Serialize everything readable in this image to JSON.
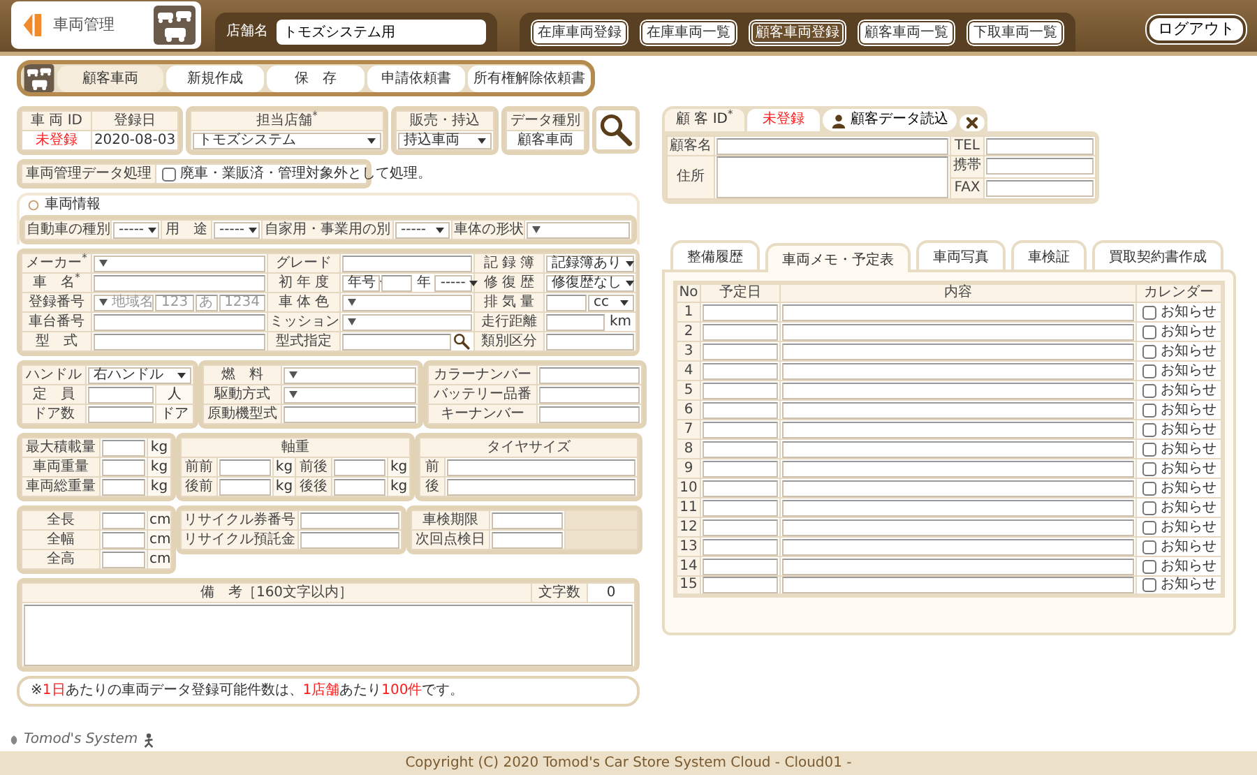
{
  "header": {
    "app_title": "車両管理",
    "store_label": "店舗名",
    "store_name": "トモズシステム用",
    "nav_buttons": [
      {
        "label": "在庫車両登録",
        "selected": false
      },
      {
        "label": "在庫車両一覧",
        "selected": false
      },
      {
        "label": "顧客車両登録",
        "selected": true
      },
      {
        "label": "顧客車両一覧",
        "selected": false
      },
      {
        "label": "下取車両一覧",
        "selected": false
      }
    ],
    "logout": "ログアウト"
  },
  "toolbar": [
    {
      "label": "顧客車両",
      "selected": true
    },
    {
      "label": "新規作成",
      "selected": false
    },
    {
      "label": "保　存",
      "selected": false
    },
    {
      "label": "申請依頼書",
      "selected": false
    },
    {
      "label": "所有権解除依頼書",
      "selected": false
    }
  ],
  "summary_boxes": [
    {
      "rows": [
        [
          {
            "kind": "label",
            "text": "車 両 ID"
          },
          {
            "kind": "label",
            "text": "登録日"
          }
        ],
        [
          {
            "kind": "text",
            "text": "未登録",
            "alert": true
          },
          {
            "kind": "text",
            "text": "2020-08-03",
            "alert": false
          }
        ]
      ]
    },
    {
      "rows": [
        [
          {
            "kind": "label",
            "text": "担当店舗$^{*}$"
          }
        ],
        [
          {
            "kind": "select",
            "value": "トモズシステム"
          }
        ]
      ]
    },
    {
      "rows": [
        [
          {
            "kind": "label",
            "text": "販売・持込"
          }
        ],
        [
          {
            "kind": "select",
            "value": "持込車両"
          }
        ]
      ]
    },
    {
      "rows": [
        [
          {
            "kind": "label",
            "text": "データ種別"
          }
        ],
        [
          {
            "kind": "text",
            "text": "顧客車両",
            "alert": false
          }
        ]
      ]
    }
  ],
  "disposal": {
    "label": "車両管理データ処理",
    "option": "廃車・業販済・管理対象外として処理。",
    "checked": false
  },
  "vehicle_info": {
    "title": "車両情報",
    "type_row": [
      {
        "kind": "label",
        "text": "自動車の種別"
      },
      {
        "kind": "select",
        "value": "-----"
      },
      {
        "kind": "label",
        "text": "用　途"
      },
      {
        "kind": "select",
        "value": "-----"
      },
      {
        "kind": "label",
        "text": "自家用・事業用の別"
      },
      {
        "kind": "select",
        "value": "-----"
      },
      {
        "kind": "label",
        "text": "車体の形状"
      },
      {
        "kind": "pick"
      }
    ],
    "main": [
      [
        {
          "kind": "label",
          "text": "メーカー$^{*}$"
        },
        {
          "kind": "pick"
        },
        {
          "kind": "label",
          "text": "グレード"
        },
        {
          "kind": "input"
        },
        {
          "kind": "label",
          "text": "記 録 簿"
        },
        {
          "kind": "select",
          "value": "記録簿あり"
        }
      ],
      [
        {
          "kind": "label",
          "text": "車　名$^{*}$"
        },
        {
          "kind": "input"
        },
        {
          "kind": "label",
          "text": "初 年 度"
        },
        {
          "kind": "group",
          "parts": [
            {
              "kind": "select",
              "value": "年号"
            },
            {
              "kind": "input"
            },
            {
              "kind": "unit",
              "text": "年"
            },
            {
              "kind": "select",
              "value": "-----"
            }
          ]
        },
        {
          "kind": "label",
          "text": "修 復 歴"
        },
        {
          "kind": "select",
          "value": "修復歴なし"
        }
      ],
      [
        {
          "kind": "label",
          "text": "登録番号"
        },
        {
          "kind": "group",
          "parts": [
            {
              "kind": "pick",
              "value": "地域名"
            },
            {
              "kind": "input",
              "placeholder": "123"
            },
            {
              "kind": "input",
              "placeholder": "あ"
            },
            {
              "kind": "input",
              "placeholder": "1234"
            }
          ]
        },
        {
          "kind": "label",
          "text": "車 体 色"
        },
        {
          "kind": "pick"
        },
        {
          "kind": "label",
          "text": "排 気 量"
        },
        {
          "kind": "group",
          "parts": [
            {
              "kind": "input"
            },
            {
              "kind": "select",
              "value": "cc"
            }
          ]
        }
      ],
      [
        {
          "kind": "label",
          "text": "車台番号"
        },
        {
          "kind": "input"
        },
        {
          "kind": "label",
          "text": "ミッション"
        },
        {
          "kind": "pick"
        },
        {
          "kind": "label",
          "text": "走行距離"
        },
        {
          "kind": "group",
          "parts": [
            {
              "kind": "input"
            },
            {
              "kind": "unit",
              "text": "km"
            }
          ]
        }
      ],
      [
        {
          "kind": "label",
          "text": "型　式"
        },
        {
          "kind": "input"
        },
        {
          "kind": "label",
          "text": "型式指定"
        },
        {
          "kind": "search"
        },
        {
          "kind": "label",
          "text": "類別区分"
        },
        {
          "kind": "input"
        }
      ]
    ],
    "panel_rows": [
      [
        {
          "rows": [
            [
              {
                "kind": "label",
                "text": "ハンドル"
              },
              {
                "kind": "select",
                "value": "右ハンドル",
                "colspan": 2
              }
            ],
            [
              {
                "kind": "label",
                "text": "定　員"
              },
              {
                "kind": "input"
              },
              {
                "kind": "unit",
                "text": "人"
              }
            ],
            [
              {
                "kind": "label",
                "text": "ドア数"
              },
              {
                "kind": "input"
              },
              {
                "kind": "unit",
                "text": "ドア"
              }
            ]
          ]
        },
        {
          "rows": [
            [
              {
                "kind": "label",
                "text": "燃　料"
              },
              {
                "kind": "pick"
              }
            ],
            [
              {
                "kind": "label",
                "text": "駆動方式"
              },
              {
                "kind": "pick"
              }
            ],
            [
              {
                "kind": "label",
                "text": "原動機型式"
              },
              {
                "kind": "input"
              }
            ]
          ]
        },
        {
          "rows": [
            [
              {
                "kind": "label",
                "text": "カラーナンバー"
              },
              {
                "kind": "input"
              }
            ],
            [
              {
                "kind": "label",
                "text": "バッテリー品番"
              },
              {
                "kind": "input"
              }
            ],
            [
              {
                "kind": "label",
                "text": "キーナンバー"
              },
              {
                "kind": "input"
              }
            ]
          ]
        }
      ],
      [
        {
          "rows": [
            [
              {
                "kind": "label",
                "text": "最大積載量"
              },
              {
                "kind": "input"
              },
              {
                "kind": "unit",
                "text": "kg"
              }
            ],
            [
              {
                "kind": "label",
                "text": "車両重量"
              },
              {
                "kind": "input"
              },
              {
                "kind": "unit",
                "text": "kg"
              }
            ],
            [
              {
                "kind": "label",
                "text": "車両総重量"
              },
              {
                "kind": "input"
              },
              {
                "kind": "unit",
                "text": "kg"
              }
            ]
          ]
        },
        {
          "rows": [
            [
              {
                "kind": "heading",
                "text": "軸重",
                "colspan": 6
              }
            ],
            [
              {
                "kind": "label",
                "text": "前前"
              },
              {
                "kind": "input"
              },
              {
                "kind": "unit",
                "text": "kg"
              },
              {
                "kind": "label",
                "text": "前後"
              },
              {
                "kind": "input"
              },
              {
                "kind": "unit",
                "text": "kg"
              }
            ],
            [
              {
                "kind": "label",
                "text": "後前"
              },
              {
                "kind": "input"
              },
              {
                "kind": "unit",
                "text": "kg"
              },
              {
                "kind": "label",
                "text": "後後"
              },
              {
                "kind": "input"
              },
              {
                "kind": "unit",
                "text": "kg"
              }
            ]
          ]
        },
        {
          "rows": [
            [
              {
                "kind": "heading",
                "text": "タイヤサイズ",
                "colspan": 2
              }
            ],
            [
              {
                "kind": "label",
                "text": "前"
              },
              {
                "kind": "input"
              }
            ],
            [
              {
                "kind": "label",
                "text": "後"
              },
              {
                "kind": "input"
              }
            ]
          ]
        }
      ],
      [
        {
          "rows": [
            [
              {
                "kind": "label",
                "text": "全長"
              },
              {
                "kind": "input"
              },
              {
                "kind": "unit",
                "text": "cm"
              }
            ],
            [
              {
                "kind": "label",
                "text": "全幅"
              },
              {
                "kind": "input"
              },
              {
                "kind": "unit",
                "text": "cm"
              }
            ],
            [
              {
                "kind": "label",
                "text": "全高"
              },
              {
                "kind": "input"
              },
              {
                "kind": "unit",
                "text": "cm"
              }
            ]
          ]
        },
        {
          "rows": [
            [
              {
                "kind": "label",
                "text": "リサイクル券番号"
              },
              {
                "kind": "input"
              }
            ],
            [
              {
                "kind": "label",
                "text": "リサイクル預託金"
              },
              {
                "kind": "input"
              }
            ]
          ]
        },
        {
          "rows": [
            [
              {
                "kind": "label",
                "text": "車検期限"
              },
              {
                "kind": "input"
              },
              {
                "kind": "blank"
              }
            ],
            [
              {
                "kind": "label",
                "text": "次回点検日"
              },
              {
                "kind": "input"
              },
              {
                "kind": "blank"
              }
            ]
          ]
        }
      ]
    ]
  },
  "remarks": {
    "label": "備　考［160文字以内］",
    "count_label": "文字数",
    "count": "0"
  },
  "note": [
    {
      "text": "※",
      "highlight": false
    },
    {
      "text": "1日",
      "highlight": true
    },
    {
      "text": "あたりの車両データ登録可能件数は、",
      "highlight": false
    },
    {
      "text": "1店舗",
      "highlight": true
    },
    {
      "text": "あたり",
      "highlight": false
    },
    {
      "text": "100件",
      "highlight": true
    },
    {
      "text": "です。",
      "highlight": false
    }
  ],
  "customer": {
    "id_label": "顧 客 ID$^{*}$",
    "id_value": "未登録",
    "load_button": "顧客データ読込",
    "rows": [
      [
        {
          "kind": "label",
          "text": "顧客名"
        },
        {
          "kind": "input"
        },
        {
          "kind": "label",
          "text": "TEL"
        },
        {
          "kind": "input"
        }
      ],
      [
        {
          "kind": "label",
          "text": "住所",
          "rowspan": 2
        },
        {
          "kind": "textarea",
          "rowspan": 2
        },
        {
          "kind": "label",
          "text": "携帯"
        },
        {
          "kind": "input"
        }
      ],
      [
        {
          "kind": "label",
          "text": "FAX"
        },
        {
          "kind": "input"
        }
      ]
    ]
  },
  "tabs": [
    {
      "label": "整備履歴",
      "selected": false
    },
    {
      "label": "車両メモ・予定表",
      "selected": true
    },
    {
      "label": "車両写真",
      "selected": false
    },
    {
      "label": "車検証",
      "selected": false
    },
    {
      "label": "買取契約書作成",
      "selected": false
    }
  ],
  "schedule": {
    "columns": [
      "No",
      "予定日",
      "内容",
      "カレンダー"
    ],
    "rows": [
      {
        "no": "1",
        "notify_label": "お知らせ",
        "checked": false
      },
      {
        "no": "2",
        "notify_label": "お知らせ",
        "checked": false
      },
      {
        "no": "3",
        "notify_label": "お知らせ",
        "checked": false
      },
      {
        "no": "4",
        "notify_label": "お知らせ",
        "checked": false
      },
      {
        "no": "5",
        "notify_label": "お知らせ",
        "checked": false
      },
      {
        "no": "6",
        "notify_label": "お知らせ",
        "checked": false
      },
      {
        "no": "7",
        "notify_label": "お知らせ",
        "checked": false
      },
      {
        "no": "8",
        "notify_label": "お知らせ",
        "checked": false
      },
      {
        "no": "9",
        "notify_label": "お知らせ",
        "checked": false
      },
      {
        "no": "10",
        "notify_label": "お知らせ",
        "checked": false
      },
      {
        "no": "11",
        "notify_label": "お知らせ",
        "checked": false
      },
      {
        "no": "12",
        "notify_label": "お知らせ",
        "checked": false
      },
      {
        "no": "13",
        "notify_label": "お知らせ",
        "checked": false
      },
      {
        "no": "14",
        "notify_label": "お知らせ",
        "checked": false
      },
      {
        "no": "15",
        "notify_label": "お知らせ",
        "checked": false
      }
    ]
  },
  "footer": {
    "brand": "Tomod's System",
    "copyright": "Copyright (C) 2020 Tomod's Car Store System Cloud - Cloud01 -"
  }
}
